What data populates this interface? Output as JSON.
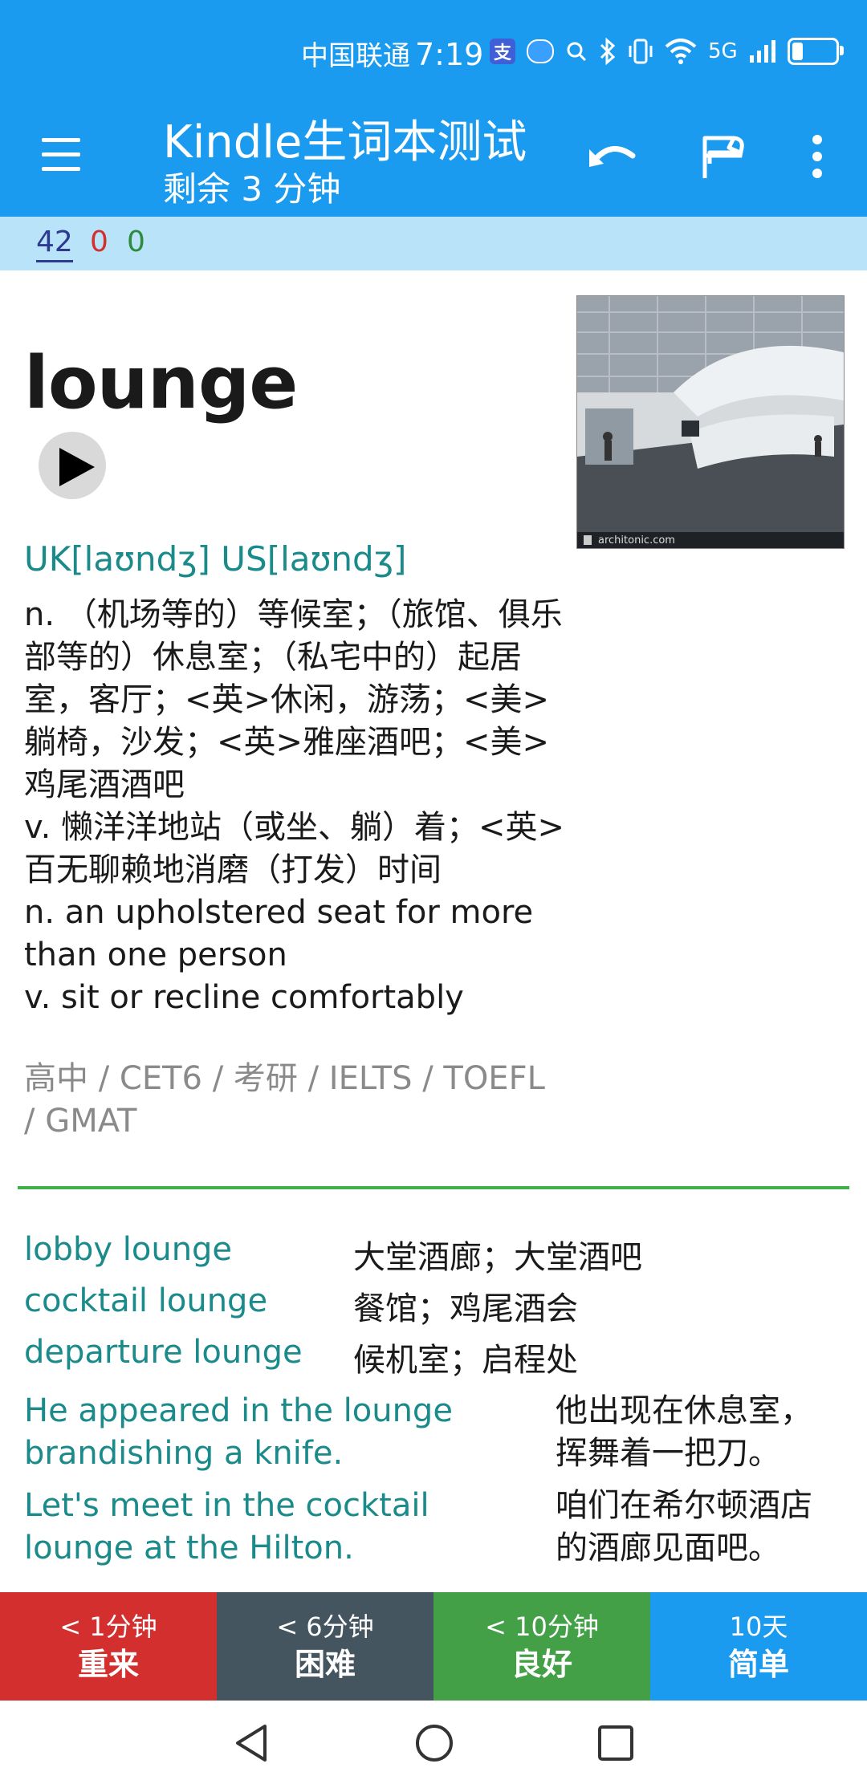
{
  "status_bar": {
    "carrier": "中国联通",
    "time": "7:19",
    "alipay_glyph": "支",
    "network": "5G",
    "battery_level": 0.25
  },
  "app_bar": {
    "title": "Kindle生词本测试",
    "subtitle": "剩余 3 分钟"
  },
  "counters": {
    "new": "42",
    "learning": "0",
    "review": "0"
  },
  "card": {
    "word": "lounge",
    "picture_caption": "architonic.com",
    "phonetic": "UK[laʊndʒ]  US[laʊndʒ]",
    "definitions": [
      "n. （机场等的）等候室；（旅馆、俱乐部等的）休息室；（私宅中的）起居室，客厅；<英>休闲，游荡；<美>躺椅，沙发；<英>雅座酒吧；<美>鸡尾酒酒吧",
      "v. 懒洋洋地站（或坐、躺）着；<英>百无聊赖地消磨（打发）时间",
      "n. an upholstered seat for more than one person",
      "v. sit or recline comfortably"
    ],
    "tags": "高中 / CET6 / 考研 / IELTS / TOEFL / GMAT",
    "phrases": [
      {
        "en": "lobby lounge",
        "zh": "大堂酒廊；大堂酒吧"
      },
      {
        "en": "cocktail lounge",
        "zh": "餐馆；鸡尾酒会"
      },
      {
        "en": "departure lounge",
        "zh": "候机室；启程处"
      }
    ],
    "examples": [
      {
        "en": "He appeared in the lounge brandishing a knife.",
        "zh": "他出现在休息室，挥舞着一把刀。"
      },
      {
        "en": "Let's meet in the cocktail lounge at the Hilton.",
        "zh": "咱们在希尔顿酒店的酒廊见面吧。"
      }
    ]
  },
  "answers": [
    {
      "interval": "< 1分钟",
      "label": "重来",
      "color": "#d32f2f"
    },
    {
      "interval": "< 6分钟",
      "label": "困难",
      "color": "#455560"
    },
    {
      "interval": "< 10分钟",
      "label": "良好",
      "color": "#43a047"
    },
    {
      "interval": "10天",
      "label": "简单",
      "color": "#1a9bef"
    }
  ],
  "colors": {
    "primary": "#1a9bef",
    "counter_bg": "#b9e3f9",
    "accent_text": "#1a8a8a",
    "divider": "#3fb04a"
  }
}
